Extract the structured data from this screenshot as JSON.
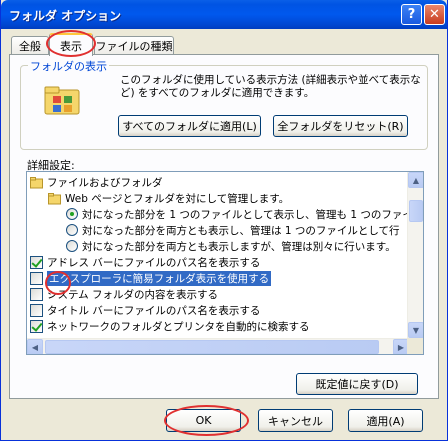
{
  "window": {
    "title": "フォルダ オプション",
    "help_glyph": "?",
    "close_glyph": "✕"
  },
  "tabs": [
    {
      "label": "全般"
    },
    {
      "label": "表示"
    },
    {
      "label": "ファイルの種類"
    }
  ],
  "folder_views": {
    "title": "フォルダの表示",
    "description": "このフォルダに使用している表示方法 (詳細表示や並べて表示など) をすべてのフォルダに適用できます。",
    "apply_all_label": "すべてのフォルダに適用(L)",
    "reset_all_label": "全フォルダをリセット(R)"
  },
  "advanced": {
    "label": "詳細設定:",
    "items": [
      {
        "text": "ファイルおよびフォルダ",
        "type": "folder"
      },
      {
        "text": "Web ページとフォルダを対にして管理します。",
        "type": "folder"
      },
      {
        "text": "対になった部分を 1 つのファイルとして表示し、管理も 1 つのファイ",
        "type": "radio",
        "checked": true
      },
      {
        "text": "対になった部分を両方とも表示し、管理は 1 つのファイルとして行",
        "type": "radio",
        "checked": false
      },
      {
        "text": "対になった部分を両方とも表示しますが、管理は別々に行います。",
        "type": "radio",
        "checked": false
      },
      {
        "text": "アドレス バーにファイルのパス名を表示する",
        "type": "checkbox",
        "checked": true
      },
      {
        "text": "エクスプローラに簡易フォルダ表示を使用する",
        "type": "checkbox",
        "checked": false
      },
      {
        "text": "システム フォルダの内容を表示する",
        "type": "checkbox",
        "checked": false
      },
      {
        "text": "タイトル バーにファイルのパス名を表示する",
        "type": "checkbox",
        "checked": false
      },
      {
        "text": "ネットワークのフォルダとプリンタを自動的に検索する",
        "type": "checkbox",
        "checked": true
      }
    ]
  },
  "restore_defaults_label": "既定値に戻す(D)",
  "footer": {
    "ok_label": "OK",
    "cancel_label": "キャンセル",
    "apply_label": "適用(A)"
  },
  "scroll": {
    "up": "▲",
    "down": "▼",
    "left": "◀",
    "right": "▶"
  }
}
